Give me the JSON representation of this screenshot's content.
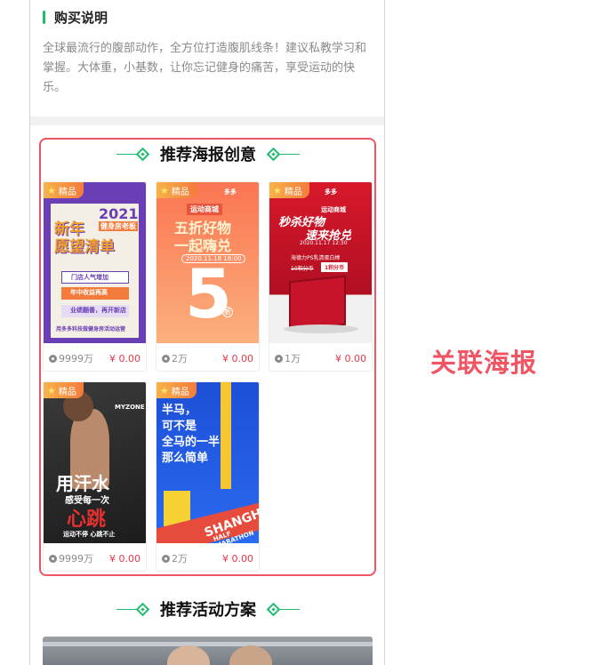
{
  "purchase": {
    "title": "购买说明",
    "text": "全球最流行的腹部动作，全方位打造腹肌线条！建议私教学习和掌握。大体重，小基数，让你忘记健身的痛苦，享受运动的快乐。"
  },
  "recommend_posters": {
    "heading": "推荐海报创意",
    "cards": [
      {
        "badge": "精品",
        "views": "9999万",
        "price": "¥ 0.00",
        "poster": {
          "year": "2021",
          "line1": "新年",
          "line2": "愿望清单",
          "sub": "健身房老板",
          "items": [
            "门店人气增加",
            "年中收益再高",
            "业绩翻番，再开新店"
          ],
          "foot": "用多多科技做健身房活动运营"
        }
      },
      {
        "badge": "精品",
        "views": "2万",
        "price": "¥ 0.00",
        "poster": {
          "tag": "运动商城",
          "brand": "多多",
          "line1": "五折好物",
          "line2": "一起嗨兑",
          "date": "2020.11.18 18:00",
          "big": "5",
          "unit": "折"
        }
      },
      {
        "badge": "精品",
        "views": "1万",
        "price": "¥ 0.00",
        "poster": {
          "tag": "运动商城",
          "brand": "多多",
          "line1": "秒杀好物",
          "line2": "速来抢兑",
          "date": "2020.11.17 12:30",
          "product": "海德力PS乳清蛋白棒",
          "price_old": "10积分币",
          "price_new": "1积分币"
        }
      },
      {
        "badge": "精品",
        "views": "9999万",
        "price": "¥ 0.00",
        "poster": {
          "logo": "MYZONE",
          "line1": "用汗水",
          "line2": "感受每一次",
          "line3": "心跳",
          "foot": "运动不停 心跳不止"
        }
      },
      {
        "badge": "精品",
        "views": "2万",
        "price": "¥ 0.00",
        "poster": {
          "lines": [
            "半马，",
            "可不是",
            "全马的一半",
            "那么简单"
          ],
          "city": "SHANGHAI",
          "sub": "HALF MARATHON"
        }
      }
    ]
  },
  "recommend_activities": {
    "heading": "推荐活动方案"
  },
  "annotation": {
    "label": "关联海报"
  },
  "colors": {
    "accent_green": "#1dbb6b",
    "highlight_red": "#ef5562",
    "price_red": "#e5384b",
    "badge_orange": "#f37b3b"
  }
}
